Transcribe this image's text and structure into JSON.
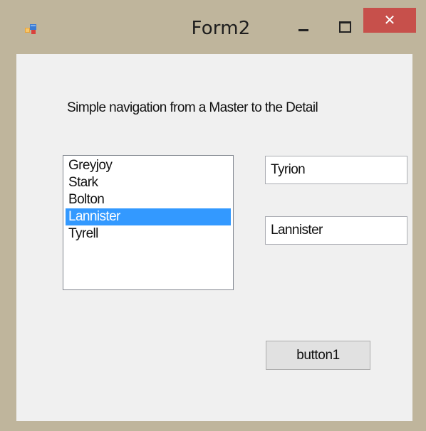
{
  "window": {
    "title": "Form2",
    "icon": "winforms-app-icon",
    "controls": {
      "minimize": "minimize-icon",
      "maximize": "maximize-icon",
      "close_label": "✕"
    },
    "colors": {
      "frame": "#bfb59c",
      "client": "#f0f0f0",
      "close": "#c7504b",
      "selection": "#3399ff"
    }
  },
  "form": {
    "intro_label": "Simple navigation from a Master to the Detail",
    "houses": [
      "Greyjoy",
      "Stark",
      "Bolton",
      "Lannister",
      "Tyrell"
    ],
    "selected_index": 3,
    "first_name_value": "Tyrion",
    "last_name_value": "Lannister",
    "button_label": "button1"
  }
}
